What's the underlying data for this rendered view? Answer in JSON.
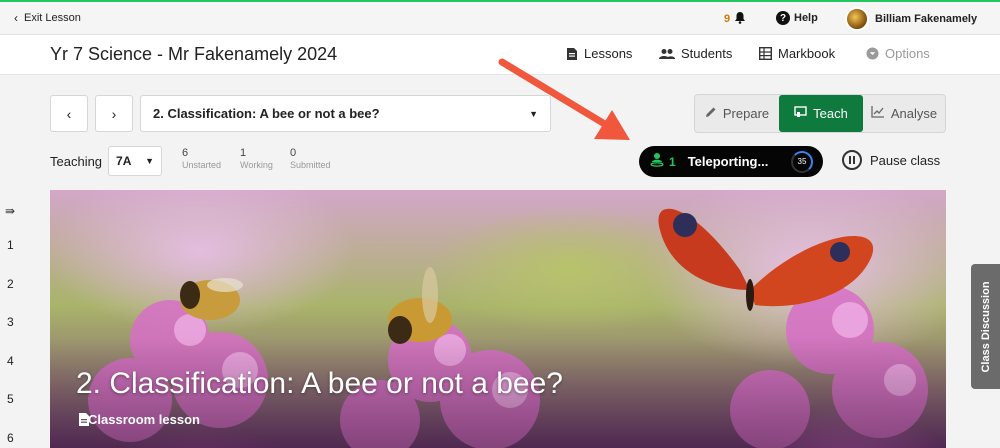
{
  "topbar": {
    "exit_label": "Exit Lesson",
    "notification_count": "9",
    "help_label": "Help",
    "user_name": "Billiam Fakenamely"
  },
  "header": {
    "course_title": "Yr 7 Science - Mr Fakenamely 2024",
    "nav": [
      {
        "label": "Lessons",
        "icon": "document-icon"
      },
      {
        "label": "Students",
        "icon": "people-icon"
      },
      {
        "label": "Markbook",
        "icon": "grid-icon"
      },
      {
        "label": "Options",
        "icon": "chevron-circle-icon",
        "disabled": true
      }
    ]
  },
  "lesson": {
    "selected": "2. Classification: A bee or not a bee?",
    "modes": [
      "Prepare",
      "Teach",
      "Analyse"
    ],
    "active_mode": "Teach"
  },
  "teaching": {
    "label": "Teaching",
    "class": "7A",
    "stats": [
      {
        "value": "6",
        "label": "Unstarted"
      },
      {
        "value": "1",
        "label": "Working"
      },
      {
        "value": "0",
        "label": "Submitted"
      }
    ]
  },
  "teleport": {
    "count": "1",
    "label": "Teleporting...",
    "timer": "35"
  },
  "pause_label": "Pause class",
  "sidebar": {
    "numbers": [
      "1",
      "2",
      "3",
      "4",
      "5",
      "6"
    ]
  },
  "banner": {
    "title": "2. Classification: A bee or not a bee?",
    "type_label": "Classroom lesson"
  },
  "discussion_tab": "Class Discussion",
  "colors": {
    "accent_green": "#0f7a3d",
    "topline": "#22c55e",
    "arrow": "#f0573d"
  }
}
